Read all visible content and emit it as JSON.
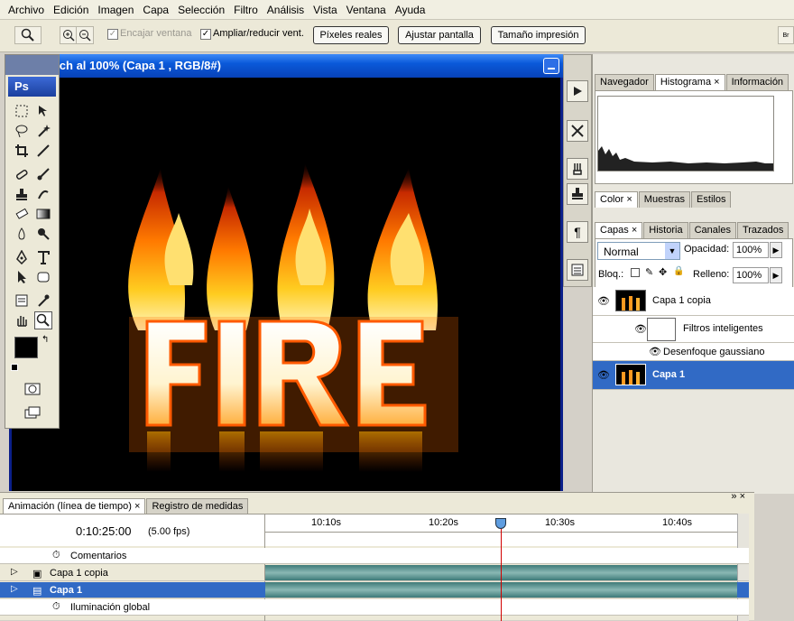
{
  "menu": [
    "Archivo",
    "Edición",
    "Imagen",
    "Capa",
    "Selección",
    "Filtro",
    "Análisis",
    "Vista",
    "Ventana",
    "Ayuda"
  ],
  "options": {
    "fit_window_label": "Encajar ventana",
    "zoom_resize_label": "Ampliar/reducir vent.",
    "actual_pixels": "Píxeles reales",
    "fit_screen": "Ajustar pantalla",
    "print_size": "Tamaño impresión",
    "fit_window_checked": true,
    "zoom_resize_checked": true
  },
  "document": {
    "title": "firetech al 100% (Capa 1 , RGB/8#)",
    "art_text": "FIRE"
  },
  "toolbox": {
    "logo": "Ps"
  },
  "panels": {
    "top_tabs": [
      "Navegador",
      "Histograma",
      "Información"
    ],
    "color_tabs": [
      "Color",
      "Muestras",
      "Estilos"
    ],
    "layer_tabs": [
      "Capas",
      "Historia",
      "Canales",
      "Trazados"
    ],
    "blend_mode": "Normal",
    "opacity_label": "Opacidad:",
    "opacity_value": "100%",
    "lock_label": "Bloq.:",
    "fill_label": "Relleno:",
    "fill_value": "100%",
    "layers": [
      {
        "name": "Capa 1 copia",
        "selected": false
      },
      {
        "name": "Filtros inteligentes",
        "selected": false
      },
      {
        "name": "Desenfoque gaussiano",
        "selected": false
      },
      {
        "name": "Capa 1",
        "selected": true
      }
    ]
  },
  "timeline": {
    "tabs": [
      "Animación (línea de tiempo)",
      "Registro de medidas"
    ],
    "time": "0:10:25:00",
    "fps": "(5.00 fps)",
    "ticks": [
      "10:10s",
      "10:20s",
      "10:30s",
      "10:40s"
    ],
    "rows": [
      "Comentarios",
      "Capa 1 copia",
      "Capa 1",
      "Iluminación global"
    ]
  },
  "colors": {
    "accent": "#316ac5",
    "title_bar": "#0a59d9",
    "track": "#5e9995"
  }
}
